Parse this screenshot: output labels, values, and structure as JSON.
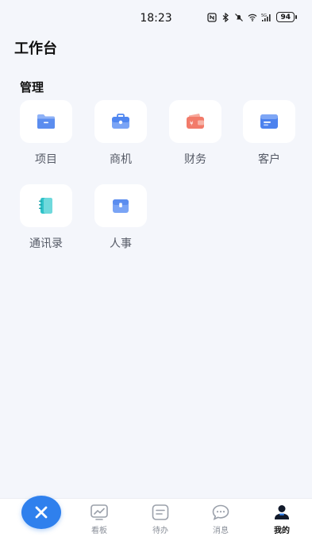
{
  "status_bar": {
    "time": "18:23",
    "battery": "94",
    "icons": [
      "nfc-icon",
      "bluetooth-icon",
      "mute-icon",
      "wifi-icon",
      "signal-5g-icon",
      "battery-icon"
    ]
  },
  "header": {
    "title": "工作台"
  },
  "management": {
    "title": "管理",
    "items": [
      {
        "label": "项目",
        "icon": "folder-icon",
        "color": "#5b8def"
      },
      {
        "label": "商机",
        "icon": "briefcase-icon",
        "color": "#4f86f0"
      },
      {
        "label": "财务",
        "icon": "wallet-icon",
        "color": "#f27b6a"
      },
      {
        "label": "客户",
        "icon": "card-icon",
        "color": "#4c82ee"
      },
      {
        "label": "通讯录",
        "icon": "contacts-book-icon",
        "color": "#2fc2c8"
      },
      {
        "label": "人事",
        "icon": "hr-folder-icon",
        "color": "#5b8def"
      }
    ]
  },
  "bottom_nav": {
    "fab_icon": "close-icon",
    "fab_color": "#2f80ed",
    "tabs": [
      {
        "label": "看板",
        "icon": "dashboard-chart-icon"
      },
      {
        "label": "待办",
        "icon": "todo-list-icon"
      },
      {
        "label": "消息",
        "icon": "message-bubble-icon"
      },
      {
        "label": "我的",
        "icon": "profile-icon",
        "active": true
      }
    ]
  }
}
